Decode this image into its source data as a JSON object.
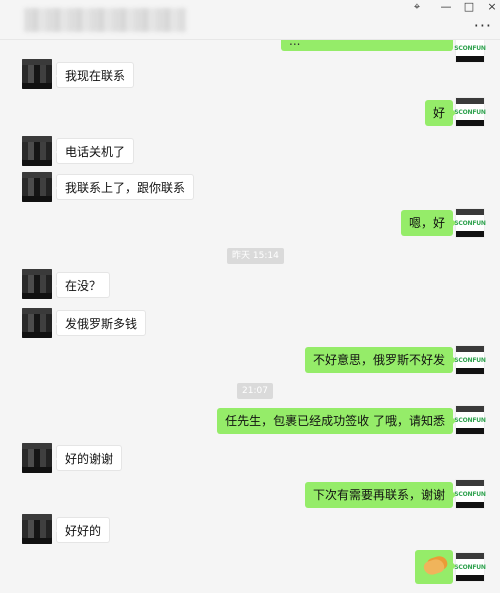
{
  "title_bar": {
    "pin_icon": "pin-icon",
    "minimize_icon": "minimize-icon",
    "maximize_icon": "maximize-icon",
    "close_icon": "close-icon",
    "more_icon": "more-icon"
  },
  "messages": {
    "partial_right": "...",
    "m1_left": "我现在联系",
    "m2_right": "好",
    "m3_left": "电话关机了",
    "m4_left": "我联系上了，跟你联系",
    "m5_right": "嗯，好",
    "time_1": "昨天 15:14",
    "m6_left": "在没？",
    "m7_left": "发俄罗斯多钱",
    "m8_right": "不好意思，俄罗斯不好发",
    "time_2": "21:07",
    "m9_right": "任先生，包裹已经成功签收 了哦，请知悉",
    "m10_left": "好的谢谢",
    "m11_right": "下次有需要再联系，谢谢",
    "m12_left": "好好的",
    "m13_right": "handshake-emoji"
  },
  "brand": {
    "name": "SCONFUN",
    "color": "#2fa24e"
  },
  "colors": {
    "right_bubble": "#95ec69",
    "left_bubble": "#ffffff",
    "background": "#f5f5f5"
  }
}
